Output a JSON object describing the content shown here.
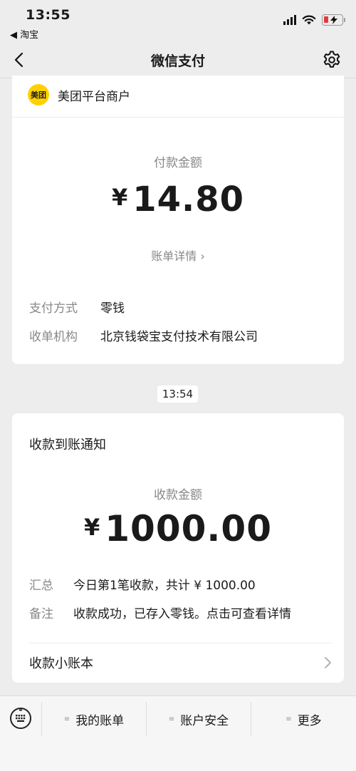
{
  "status_bar": {
    "time": "13:55",
    "back_app": "◀ 淘宝"
  },
  "nav": {
    "title": "微信支付",
    "back_icon": "chevron-left-icon",
    "settings_icon": "gear-icon"
  },
  "payment_card": {
    "merchant_logo_text": "美团",
    "merchant_name": "美团平台商户",
    "amount_label": "付款金额",
    "currency": "¥",
    "amount": "14.80",
    "bill_detail": "账单详情 ›",
    "rows": [
      {
        "key": "支付方式",
        "value": "零钱"
      },
      {
        "key": "收单机构",
        "value": "北京钱袋宝支付技术有限公司"
      }
    ]
  },
  "timestamp": "13:54",
  "receipt_card": {
    "title": "收款到账通知",
    "amount_label": "收款金额",
    "currency": "¥",
    "amount": "1000.00",
    "rows": [
      {
        "key": "汇总",
        "value": "今日第1笔收款，共计 ¥ 1000.00"
      },
      {
        "key": "备注",
        "value": "收款成功，已存入零钱。点击可查看详情"
      }
    ],
    "ledger_link": "收款小账本"
  },
  "bottom_menu": {
    "items": [
      {
        "label": "我的账单"
      },
      {
        "label": "账户安全"
      },
      {
        "label": "更多"
      }
    ]
  },
  "colors": {
    "background": "#ededed",
    "merchant_logo": "#ffd100",
    "battery_low": "#e5383b"
  }
}
